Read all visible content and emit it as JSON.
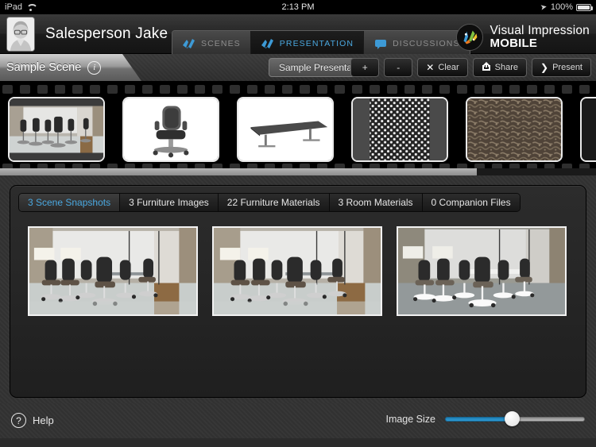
{
  "statusbar": {
    "device": "iPad",
    "wifi_icon": "wifi-icon",
    "time": "2:13 PM",
    "location_icon": "location-arrow-icon",
    "battery_percent": "100%",
    "battery_icon": "battery-full-icon"
  },
  "topbar": {
    "avatar_name": "avatar",
    "username": "Salesperson Jake",
    "segments": [
      {
        "label": "SCENES",
        "icon": "scenes-icon",
        "active": false
      },
      {
        "label": "PRESENTATION",
        "icon": "presentation-icon",
        "active": true
      },
      {
        "label": "DISCUSSIONS",
        "icon": "discussions-speech-bubble-icon",
        "active": false
      }
    ],
    "brand": {
      "icon": "visual-impression-splash-logo",
      "line1": "Visual Impression",
      "line2": "MOBILE"
    }
  },
  "toolbar": {
    "scene_name": "Sample Scene",
    "info_icon": "info-icon",
    "info_glyph": "i",
    "presentation_name": "Sample Presentation",
    "buttons": [
      {
        "label": "+",
        "icon": "plus-icon",
        "name": "add-button"
      },
      {
        "label": "-",
        "icon": "minus-icon",
        "name": "remove-button"
      },
      {
        "label": "Clear",
        "icon": "x-icon",
        "glyph": "✕",
        "name": "clear-button"
      },
      {
        "label": "Share",
        "icon": "share-export-icon",
        "glyph": "↱",
        "name": "share-button"
      },
      {
        "label": "Present",
        "icon": "play-arrow-icon",
        "glyph": "❯",
        "name": "present-button"
      }
    ]
  },
  "filmstrip": {
    "frames": [
      {
        "name": "filmstrip-frame-office-scene",
        "kind": "scene-photo"
      },
      {
        "name": "filmstrip-frame-task-chair",
        "kind": "furniture-chair"
      },
      {
        "name": "filmstrip-frame-conference-table",
        "kind": "furniture-table"
      },
      {
        "name": "filmstrip-frame-perforated-material",
        "kind": "material-dots"
      },
      {
        "name": "filmstrip-frame-carpet-material",
        "kind": "material-carpet"
      },
      {
        "name": "filmstrip-frame-dark-image",
        "kind": "dark"
      }
    ],
    "scrollbar": "horizontal-scrollbar"
  },
  "content": {
    "tabs": [
      {
        "label": "3 Scene Snapshots",
        "active": true
      },
      {
        "label": "3 Furniture Images",
        "active": false
      },
      {
        "label": "22 Furniture Materials",
        "active": false
      },
      {
        "label": "3 Room Materials",
        "active": false
      },
      {
        "label": "0 Companion Files",
        "active": false
      }
    ],
    "thumbnails": [
      {
        "name": "scene-snapshot-1",
        "variant": "warm"
      },
      {
        "name": "scene-snapshot-2",
        "variant": "warm"
      },
      {
        "name": "scene-snapshot-3",
        "variant": "cool"
      }
    ]
  },
  "footer": {
    "help_icon": "question-mark-icon",
    "help_glyph": "?",
    "help_label": "Help",
    "image_size_label": "Image Size",
    "image_size_value": 48
  },
  "colors": {
    "accent_blue": "#4aa8e0",
    "slider_blue": "#2f9bd4",
    "panel_dark": "#1f1f1f",
    "background": "#313131"
  }
}
